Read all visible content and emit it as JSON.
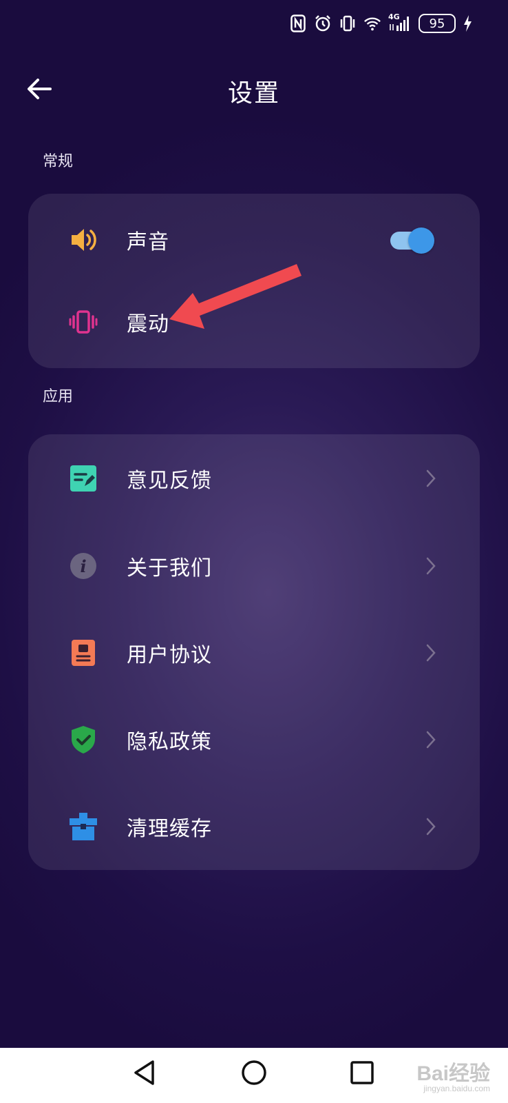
{
  "status_bar": {
    "battery": "95",
    "network": "4G",
    "icons": [
      "nfc-icon",
      "alarm-icon",
      "vibrate-mode-icon",
      "wifi-icon",
      "signal-icon",
      "battery-icon",
      "charging-icon"
    ]
  },
  "header": {
    "title": "设置",
    "back_icon": "arrow-left-icon"
  },
  "sections": {
    "general": {
      "label": "常规",
      "items": [
        {
          "label": "声音",
          "icon": "speaker-icon",
          "icon_color": "#f5b041",
          "toggle_on": true
        },
        {
          "label": "震动",
          "icon": "vibration-icon",
          "icon_color": "#e0338f"
        }
      ]
    },
    "apps": {
      "label": "应用",
      "items": [
        {
          "label": "意见反馈",
          "icon": "feedback-icon",
          "icon_color": "#3fd3b2"
        },
        {
          "label": "关于我们",
          "icon": "info-icon",
          "icon_color": "#6b6580"
        },
        {
          "label": "用户协议",
          "icon": "agreement-icon",
          "icon_color": "#f47a55"
        },
        {
          "label": "隐私政策",
          "icon": "shield-check-icon",
          "icon_color": "#2aa84a"
        },
        {
          "label": "清理缓存",
          "icon": "toolbox-icon",
          "icon_color": "#2e8fe6"
        }
      ]
    }
  },
  "annotation": {
    "icon": "red-arrow-icon",
    "color": "#f04a50"
  },
  "nav_bar": {
    "back": "triangle-back-icon",
    "home": "circle-home-icon",
    "recents": "square-recents-icon",
    "watermark": "Bai经验",
    "watermark_sub": "jingyan.baidu.com"
  }
}
